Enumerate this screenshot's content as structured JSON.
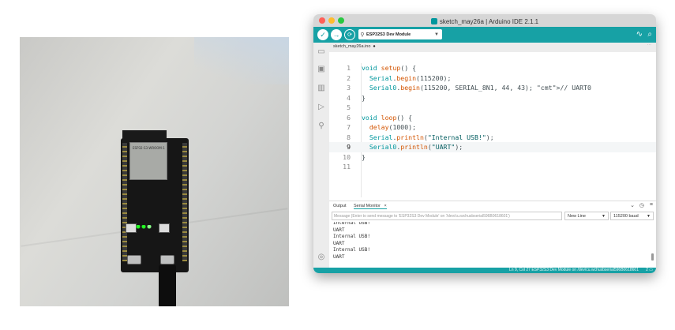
{
  "window": {
    "title": "sketch_may26a | Arduino IDE 2.1.1"
  },
  "toolbar": {
    "board": "ESP32S3 Dev Module"
  },
  "editor": {
    "filename": "sketch_may26a.ino",
    "current_line": 9,
    "lines": [
      {
        "n": "1",
        "code": "void setup() {"
      },
      {
        "n": "2",
        "code": "  Serial.begin(115200);"
      },
      {
        "n": "3",
        "code": "  Serial0.begin(115200, SERIAL_8N1, 44, 43); // UART0"
      },
      {
        "n": "4",
        "code": "}"
      },
      {
        "n": "5",
        "code": ""
      },
      {
        "n": "6",
        "code": "void loop() {"
      },
      {
        "n": "7",
        "code": "  delay(1000);"
      },
      {
        "n": "8",
        "code": "  Serial.println(\"Internal USB!\");"
      },
      {
        "n": "9",
        "code": "  Serial0.println(\"UART\");"
      },
      {
        "n": "10",
        "code": "}"
      },
      {
        "n": "11",
        "code": ""
      }
    ]
  },
  "panel": {
    "tab_output": "Output",
    "tab_serial": "Serial Monitor",
    "message_placeholder": "Message (Enter to send message to 'ESP32S3 Dev Module' on '/dev/cu.wchusbserial596B0618601')",
    "line_ending": "New Line",
    "baud": "115200 baud",
    "output_lines": [
      "Internal USB!",
      "UART",
      "Internal USB!",
      "UART",
      "Internal USB!",
      "UART"
    ]
  },
  "status": {
    "text": "Ln 9, Col 27   ESP32S3 Dev Module on /dev/cu.wchusbserial596B0618601",
    "badge": "2"
  },
  "photo": {
    "module_label": "ESP32-S3-WROOM-1"
  }
}
